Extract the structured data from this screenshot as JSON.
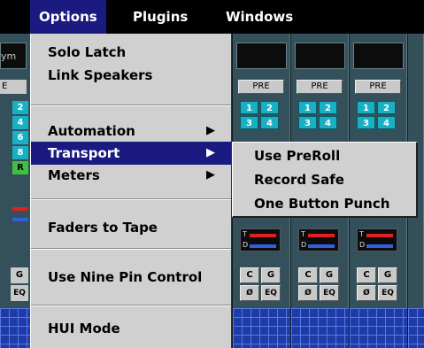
{
  "menubar": {
    "options": "Options",
    "plugins": "Plugins",
    "windows": "Windows"
  },
  "options_menu": {
    "items": [
      {
        "label": "Solo Latch"
      },
      {
        "label": "Link Speakers"
      },
      {
        "label": "Automation",
        "submenu": true
      },
      {
        "label": "Transport",
        "submenu": true,
        "highlighted": true
      },
      {
        "label": "Meters",
        "submenu": true
      },
      {
        "label": "Faders to Tape"
      },
      {
        "label": "Use Nine Pin Control"
      },
      {
        "label": "HUI Mode"
      }
    ]
  },
  "transport_submenu": {
    "items": [
      {
        "label": "Use PreRoll"
      },
      {
        "label": "Record Safe"
      },
      {
        "label": "One Button Punch"
      }
    ]
  },
  "mixer": {
    "left_labels": [
      "ym",
      "E",
      "2",
      "4",
      "6",
      "8",
      "R",
      "G",
      "EQ"
    ],
    "pre_label": "PRE",
    "io_buttons": [
      "1",
      "2",
      "3",
      "4"
    ],
    "trim_t": "T",
    "trim_d": "D",
    "c_label": "C",
    "g_label": "G",
    "phase_label": "Ø",
    "eq_label": "EQ"
  },
  "colors": {
    "menu_highlight": "#1a1a80",
    "menu_bg": "#d0d0d0",
    "io_button": "#18b0c4"
  }
}
